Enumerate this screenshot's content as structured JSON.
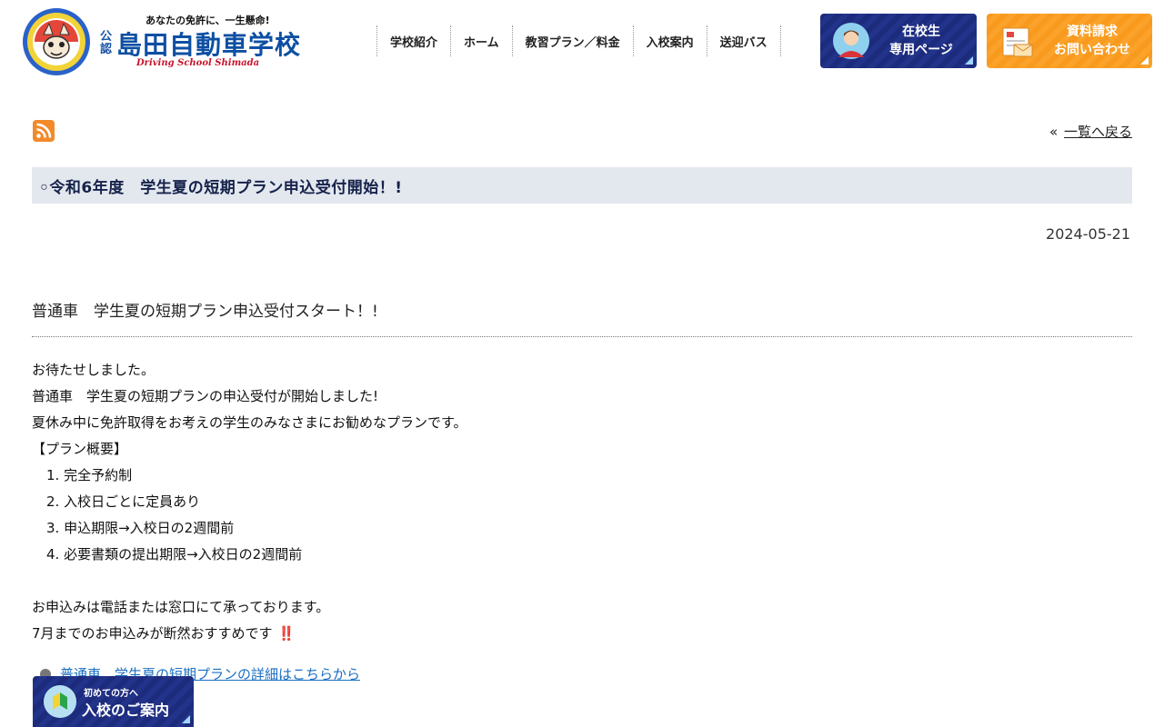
{
  "header": {
    "tagline": "あなたの免許に、一生懸命!",
    "logo_prefix": "公認",
    "school_name": "島田自動車学校",
    "school_name_en": "Driving School Shimada",
    "nav": [
      {
        "label": "学校紹介"
      },
      {
        "label": "ホーム"
      },
      {
        "label": "教習プラン／料金"
      },
      {
        "label": "入校案内"
      },
      {
        "label": "送迎バス"
      }
    ],
    "student_button": {
      "line1": "在校生",
      "line2": "専用ページ",
      "icon": "student-avatar-icon",
      "color": "#1d2b7c"
    },
    "request_button": {
      "line1": "資料請求",
      "line2": "お問い合わせ",
      "icon": "document-mail-icon",
      "color": "#f89a1e"
    }
  },
  "content": {
    "rss_icon": "rss-icon",
    "back_prefix": "«",
    "back_label": "一覧へ戻る",
    "title": "◦令和6年度　学生夏の短期プラン申込受付開始！!",
    "date": "2024-05-21",
    "subtitle": "普通車　学生夏の短期プラン申込受付スタート！!",
    "intro": [
      "お待たせしました。",
      "普通車　学生夏の短期プランの申込受付が開始しました!",
      "夏休み中に免許取得をお考えの学生のみなさまにお勧めなプランです。"
    ],
    "overview_heading": "【プラン概要】",
    "overview_items": [
      "1. 完全予約制",
      "2. 入校日ごとに定員あり",
      "3. 申込期限→入校日の2週間前",
      "4. 必要書類の提出期限→入校日の2週間前"
    ],
    "closing": [
      "お申込みは電話または窓口にて承っております。",
      "7月までのお申込みが断然おすすめです"
    ],
    "closing_emoji": "‼️",
    "detail_link": "普通車　学生夏の短期プランの詳細はこちらから"
  },
  "floating_button": {
    "sub": "初めての方へ",
    "main": "入校のご案内",
    "icon": "beginner-mark-icon"
  },
  "colors": {
    "brand_blue": "#0d4fa3",
    "title_bg": "#e3e7ee",
    "link": "#1a6fc2",
    "accent_orange": "#f89a1e",
    "emoji_red": "#e0242f"
  }
}
